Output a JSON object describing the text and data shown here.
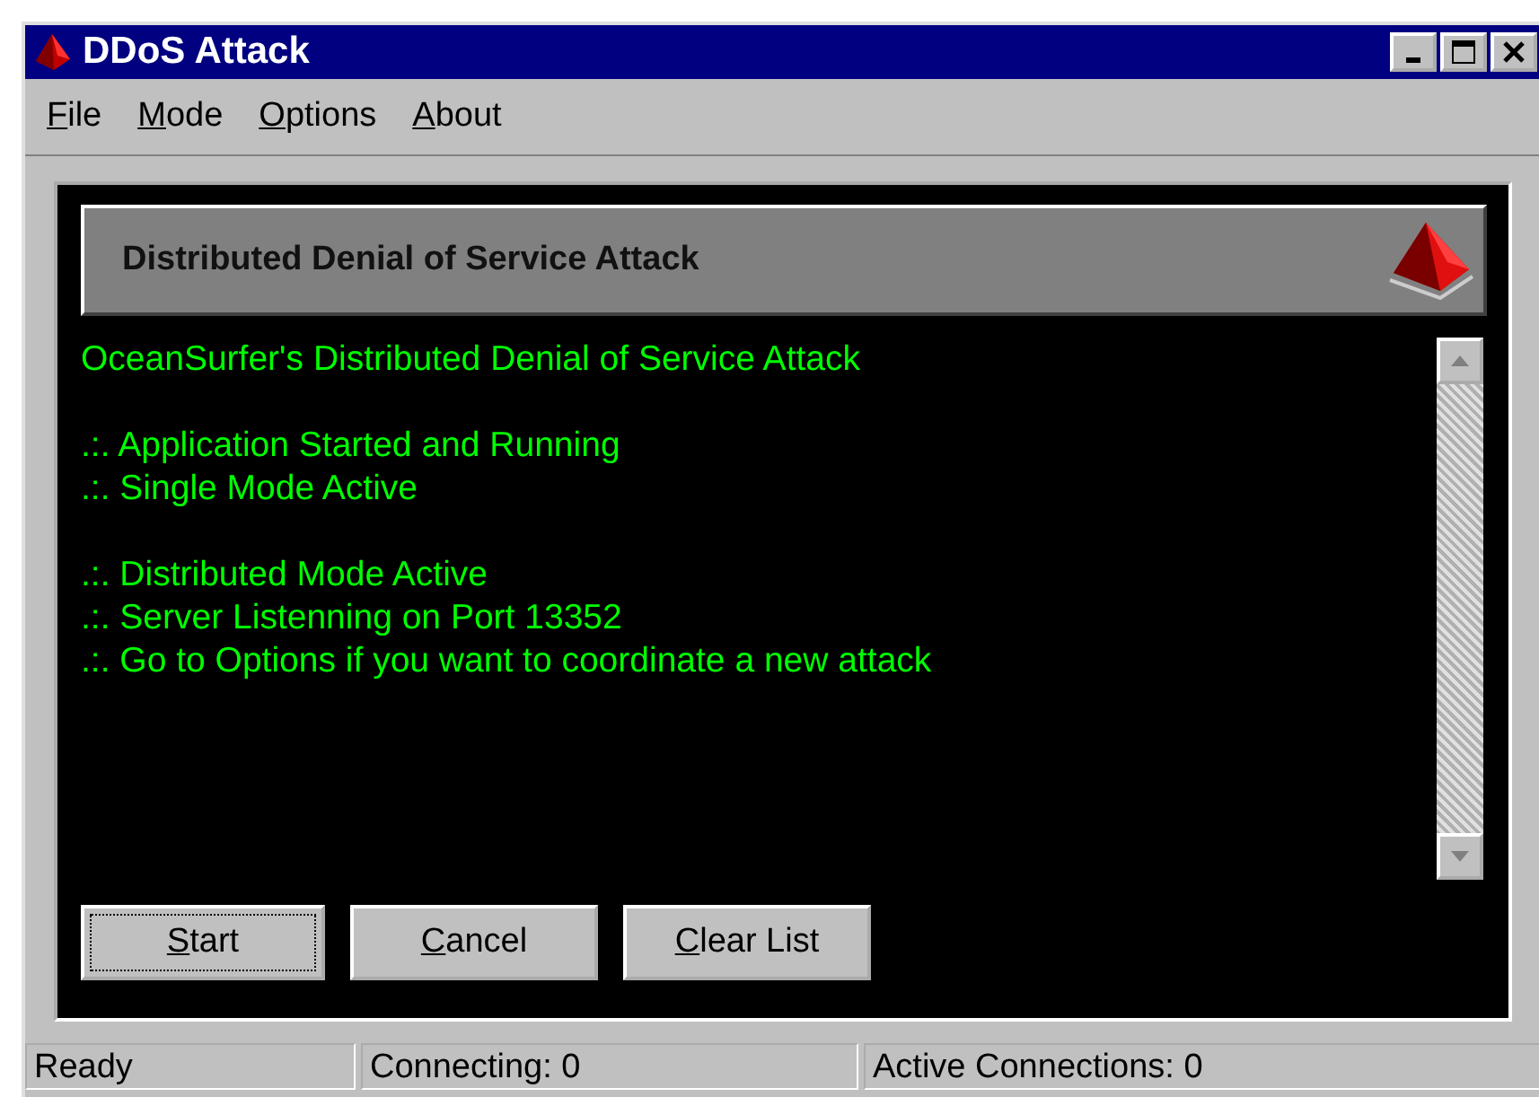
{
  "window": {
    "title": "DDoS Attack"
  },
  "menu": [
    "File",
    "Mode",
    "Options",
    "About"
  ],
  "header": {
    "title": "Distributed Denial of Service Attack"
  },
  "log_groups": [
    {
      "lines": [
        "OceanSurfer's Distributed Denial of Service Attack"
      ]
    },
    {
      "lines": [
        ".:. Application Started and Running",
        ".:. Single Mode Active"
      ]
    },
    {
      "lines": [
        ".:. Distributed Mode Active",
        ".:. Server Listenning on Port 13352",
        ".:. Go to Options if you want to coordinate a new attack"
      ]
    }
  ],
  "buttons": [
    {
      "label": "Start",
      "focused": true
    },
    {
      "label": "Cancel",
      "focused": false
    },
    {
      "label": "Clear List",
      "focused": false
    }
  ],
  "status_bar": [
    "Ready",
    "Connecting: 0",
    "Active Connections: 0"
  ]
}
